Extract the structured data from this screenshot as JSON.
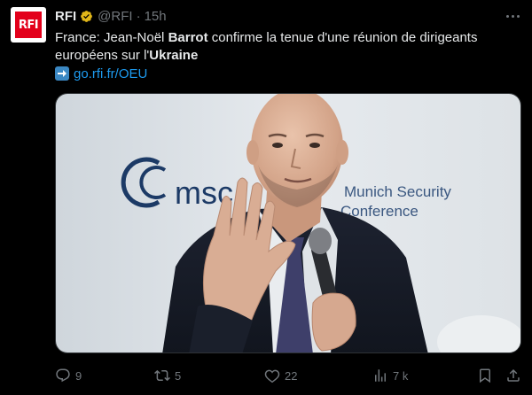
{
  "tweet": {
    "avatar_text": "RFI",
    "display_name": "RFI",
    "handle": "@RFI",
    "separator": "·",
    "time": "15h",
    "text_parts": [
      {
        "text": "France: Jean-Noël ",
        "bold": false
      },
      {
        "text": "Barrot",
        "bold": true
      },
      {
        "text": " confirme la tenue d'une réunion de dirigeants européens sur l'",
        "bold": false
      },
      {
        "text": "Ukraine",
        "bold": true
      }
    ],
    "link_text": "go.rfi.fr/OEU",
    "media": {
      "backdrop_logo": "msc",
      "backdrop_line1": "Munich Security",
      "backdrop_line2": "Conference"
    },
    "actions": {
      "replies": "9",
      "reposts": "5",
      "likes": "22",
      "views": "7 k"
    }
  },
  "icons": {
    "verified": "verified-badge-icon",
    "more": "more-icon",
    "reply": "reply-icon",
    "repost": "repost-icon",
    "like": "like-icon",
    "views": "views-icon",
    "bookmark": "bookmark-icon",
    "share": "share-icon",
    "link_arrow": "arrow-right-emoji-icon"
  },
  "colors": {
    "background": "#000000",
    "text": "#e7e9ea",
    "muted": "#71767b",
    "link": "#1d9bf0",
    "verified_gold": "#e2b719",
    "rfi_red": "#e3001b"
  }
}
